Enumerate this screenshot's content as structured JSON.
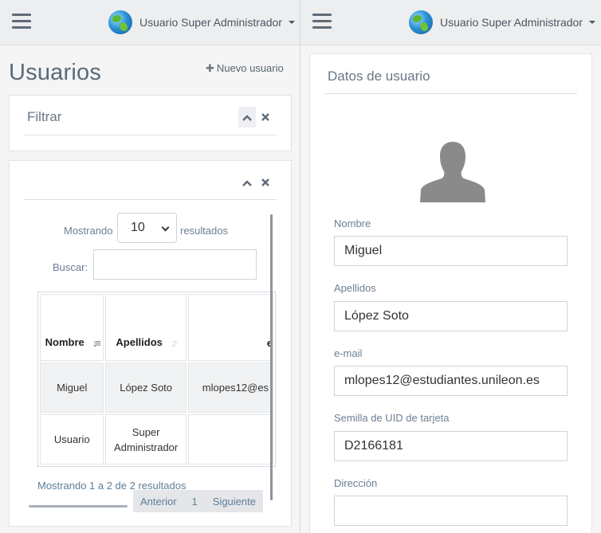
{
  "header": {
    "user_name": "Usuario Super Administrador",
    "menu_icon": "hamburger-icon",
    "avatar_icon": "globe-icon"
  },
  "left": {
    "title": "Usuarios",
    "new_user_label": "Nuevo usuario",
    "filter_box": {
      "title": "Filtrar",
      "collapse_icon": "chevron-up-icon",
      "close_icon": "close-icon"
    },
    "table_box": {
      "length_prefix": "Mostrando",
      "length_value": "10",
      "length_suffix": "resultados",
      "search_label": "Buscar:",
      "search_value": "",
      "columns": [
        "Nombre",
        "Apellidos",
        "e"
      ],
      "rows": [
        {
          "nombre": "Miguel",
          "apellidos": "López Soto",
          "email": "mlopes12@es"
        },
        {
          "nombre": "Usuario",
          "apellidos": "Super Administrador",
          "email": ""
        }
      ],
      "info": "Mostrando 1 a 2 de 2 resultados",
      "pagination": {
        "prev": "Anterior",
        "page": "1",
        "next": "Siguiente"
      }
    }
  },
  "right": {
    "title": "Datos de usuario",
    "avatar_icon": "user-silhouette-icon",
    "fields": {
      "nombre": {
        "label": "Nombre",
        "value": "Miguel"
      },
      "apellidos": {
        "label": "Apellidos",
        "value": "López Soto"
      },
      "email": {
        "label": "e-mail",
        "value": "mlopes12@estudiantes.unileon.es"
      },
      "uid": {
        "label": "Semilla de UID de tarjeta",
        "value": "D2166181"
      },
      "direccion": {
        "label": "Dirección",
        "value": ""
      }
    }
  },
  "colors": {
    "accent_text": "#5d7e99",
    "title": "#5a6a7a",
    "icon": "#5d6b79"
  }
}
